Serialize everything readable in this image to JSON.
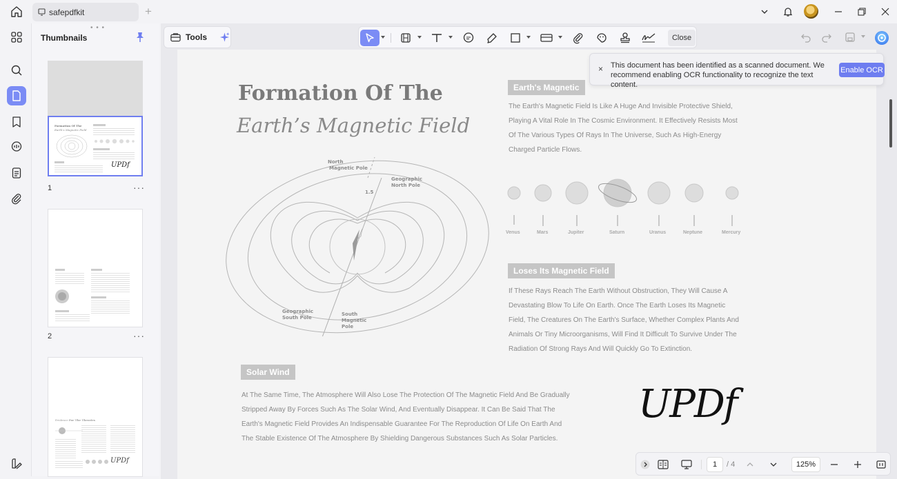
{
  "titlebar": {
    "tab_label": "safepdfkit",
    "new_tab": "+"
  },
  "thumbnails": {
    "title": "Thumbnails",
    "drag_handle": "• • •",
    "pages": [
      {
        "number": "1",
        "more": "···"
      },
      {
        "number": "2",
        "more": "···"
      },
      {
        "number": "",
        "more": ""
      }
    ],
    "thumb1": {
      "title1": "Formation Of The",
      "title2": "Earth's Magnetic Field",
      "signature": "UPDf"
    },
    "thumb3": {
      "heading_prefix": "Evidence",
      "heading": "For The Theories",
      "signature": "UPDf"
    }
  },
  "toolbar": {
    "tools_label": "Tools",
    "close_label": "Close"
  },
  "notification": {
    "text": "This document has been identified as a scanned document. We recommend enabling OCR functionality to recognize the text content.",
    "button": "Enable OCR",
    "close": "×"
  },
  "document": {
    "title_line1": "Formation Of The",
    "title_line2": "Earth’s Magnetic Field",
    "diagram_labels": {
      "north_magnetic": "North Magnetic Pole",
      "north_magnetic_l1": "North",
      "north_magnetic_l2": "Magnetic Pole",
      "geo_north_l1": "Geographic",
      "geo_north_l2": "North Pole",
      "angle": "1.5",
      "geo_south_l1": "Geographic",
      "geo_south_l2": "South Pole",
      "south_mag_l1": "South",
      "south_mag_l2": "Magnetic",
      "south_mag_l3": "Pole"
    },
    "section1": {
      "heading": "Earth's Magnetic",
      "lines": [
        "The Earth's Magnetic Field Is Like A Huge And Invisible Protective Shield,",
        "Playing A Vital Role In The Cosmic Environment. It Effectively Resists Most",
        "Of The Various Types Of Rays In The Universe, Such As High-Energy",
        "Charged Particle Flows."
      ]
    },
    "planets": [
      "Venus",
      "Mars",
      "Jupiter",
      "Saturn",
      "Uranus",
      "Neptune",
      "Mercury"
    ],
    "section2": {
      "heading": "Loses Its Magnetic Field",
      "lines": [
        "If These Rays Reach The Earth Without Obstruction, They Will Cause A",
        "Devastating Blow To Life On Earth. Once The Earth Loses Its Magnetic",
        "Field, The Creatures On The Earth's Surface, Whether Complex Plants And",
        "Animals Or Tiny Microorganisms, Will Find It Difficult To Survive Under The",
        "Radiation Of Strong Rays And Will Quickly Go To Extinction."
      ]
    },
    "section3": {
      "heading": "Solar Wind",
      "lines": [
        "At The Same Time, The Atmosphere Will Also Lose The Protection Of The Magnetic Field And Be Gradually",
        "Stripped Away By Forces Such As The Solar Wind, And Eventually Disappear. It Can Be Said That The",
        "Earth's Magnetic Field Provides An Indispensable Guarantee For The Reproduction Of Life On Earth And",
        "The Stable Existence Of The Atmosphere By Shielding Dangerous Substances Such As Solar Particles."
      ]
    },
    "signature": "UPDf"
  },
  "bottombar": {
    "current_page": "1",
    "total_pages": "/ 4",
    "zoom": "125%"
  },
  "colors": {
    "accent": "#7b8cf5",
    "ocr_button": "#6e7df0"
  }
}
